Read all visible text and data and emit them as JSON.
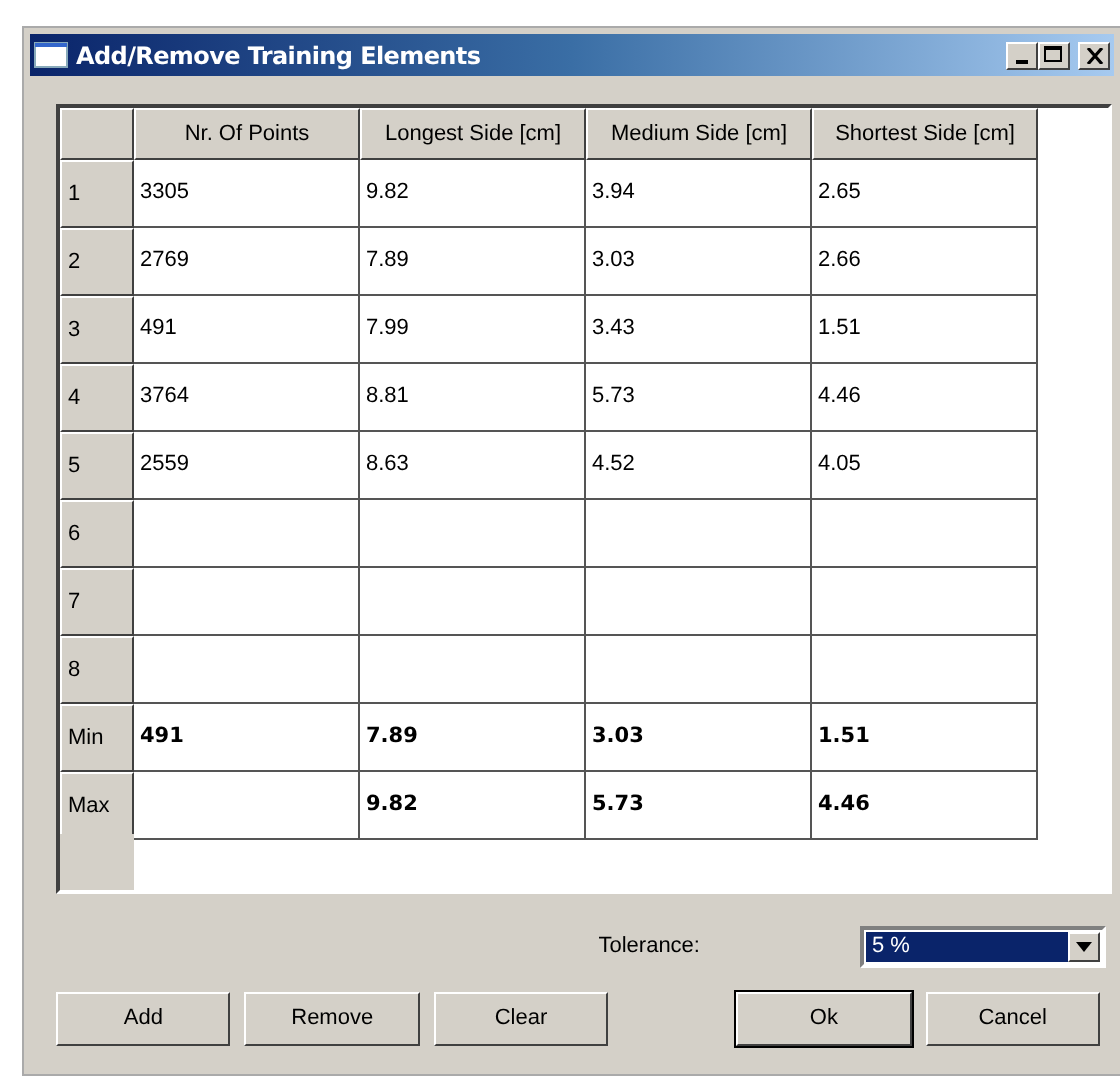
{
  "window": {
    "title": "Add/Remove Training Elements"
  },
  "table": {
    "columns": [
      "Nr. Of Points",
      "Longest Side [cm]",
      "Medium Side [cm]",
      "Shortest Side [cm]"
    ],
    "rows": [
      {
        "header": "1",
        "kind": "data",
        "cells": [
          "3305",
          "9.82",
          "3.94",
          "2.65"
        ]
      },
      {
        "header": "2",
        "kind": "data",
        "cells": [
          "2769",
          "7.89",
          "3.03",
          "2.66"
        ]
      },
      {
        "header": "3",
        "kind": "data",
        "cells": [
          "491",
          "7.99",
          "3.43",
          "1.51"
        ]
      },
      {
        "header": "4",
        "kind": "data",
        "cells": [
          "3764",
          "8.81",
          "5.73",
          "4.46"
        ]
      },
      {
        "header": "5",
        "kind": "data",
        "cells": [
          "2559",
          "8.63",
          "4.52",
          "4.05"
        ]
      },
      {
        "header": "6",
        "kind": "data",
        "cells": [
          null,
          null,
          null,
          null
        ]
      },
      {
        "header": "7",
        "kind": "data",
        "cells": [
          null,
          null,
          null,
          null
        ]
      },
      {
        "header": "8",
        "kind": "data",
        "cells": [
          null,
          null,
          null,
          null
        ]
      },
      {
        "header": "Min",
        "kind": "summary",
        "cells": [
          "491",
          "7.89",
          "3.03",
          "1.51"
        ]
      },
      {
        "header": "Max",
        "kind": "summary",
        "cells": [
          null,
          "9.82",
          "5.73",
          "4.46"
        ]
      }
    ]
  },
  "tolerance": {
    "label": "Tolerance:",
    "value": "5 %",
    "focused": true
  },
  "buttons": [
    {
      "label": "Add",
      "default": false
    },
    {
      "label": "Remove",
      "default": false
    },
    {
      "label": "Clear",
      "default": false
    },
    {
      "label": "Ok",
      "default": true
    },
    {
      "label": "Cancel",
      "default": false
    }
  ]
}
